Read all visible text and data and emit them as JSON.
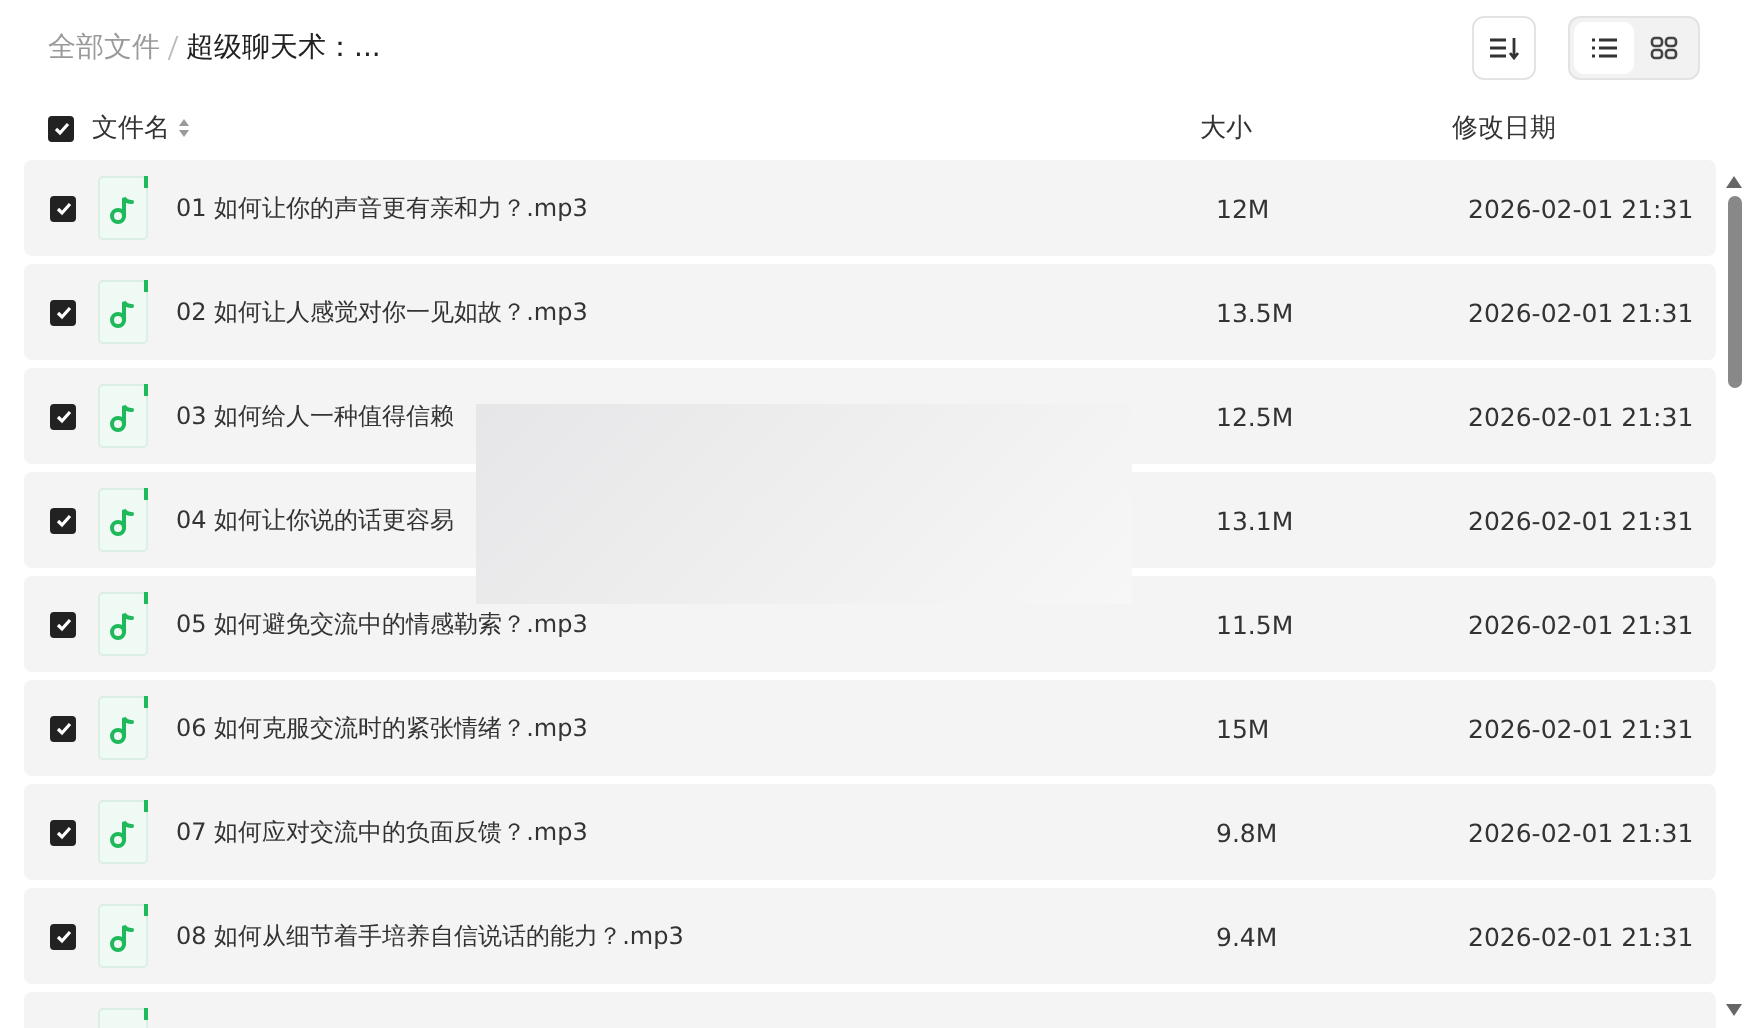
{
  "breadcrumb": [
    {
      "label": "全部文件",
      "current": false
    },
    {
      "label": "超级聊天术：...",
      "current": true
    }
  ],
  "view_toggle": [
    {
      "kind": "list",
      "selected": true
    },
    {
      "kind": "grid",
      "selected": false
    }
  ],
  "header": {
    "checked": true,
    "columns": [
      "文件名",
      "大小",
      "修改日期"
    ]
  },
  "rows": [
    {
      "checked": true,
      "name": "01 如何让你的声音更有亲和力？.mp3",
      "size": "12M",
      "date": "2026-02-01 21:31"
    },
    {
      "checked": true,
      "name": "02 如何让人感觉对你一见如故？.mp3",
      "size": "13.5M",
      "date": "2026-02-01 21:31"
    },
    {
      "checked": true,
      "name": "03 如何给人一种值得信赖",
      "size": "12.5M",
      "date": "2026-02-01 21:31"
    },
    {
      "checked": true,
      "name": "04 如何让你说的话更容易",
      "size": "13.1M",
      "date": "2026-02-01 21:31"
    },
    {
      "checked": true,
      "name": "05 如何避免交流中的情感勒索？.mp3",
      "size": "11.5M",
      "date": "2026-02-01 21:31"
    },
    {
      "checked": true,
      "name": "06 如何克服交流时的紧张情绪？.mp3",
      "size": "15M",
      "date": "2026-02-01 21:31"
    },
    {
      "checked": true,
      "name": "07 如何应对交流中的负面反馈？.mp3",
      "size": "9.8M",
      "date": "2026-02-01 21:31"
    },
    {
      "checked": true,
      "name": "08 如何从细节着手培养自信说话的能力？.mp3",
      "size": "9.4M",
      "date": "2026-02-01 21:31"
    }
  ]
}
